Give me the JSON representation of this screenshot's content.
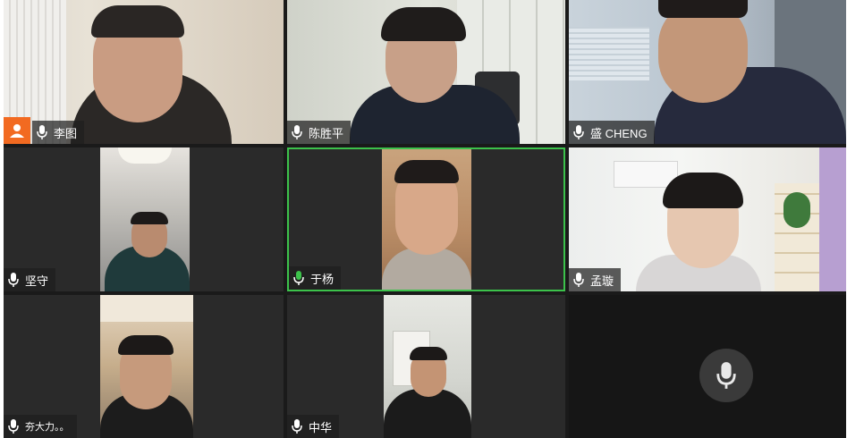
{
  "participants": [
    {
      "name": "李图"
    },
    {
      "name": "陈胜平"
    },
    {
      "name": "盛 CHENG"
    },
    {
      "name": "坚守"
    },
    {
      "name": "于杨",
      "speaking": true
    },
    {
      "name": "孟璇"
    },
    {
      "name": "夯大力。。"
    },
    {
      "name": "中华"
    }
  ],
  "colors": {
    "speaking_border": "#3cc24b",
    "avatar_badge": "#f26a21",
    "tile_bg": "#2a2a2a",
    "grid_bg": "#1a1a1a"
  },
  "icons": {
    "mic": "microphone-icon",
    "avatar": "user-icon"
  }
}
